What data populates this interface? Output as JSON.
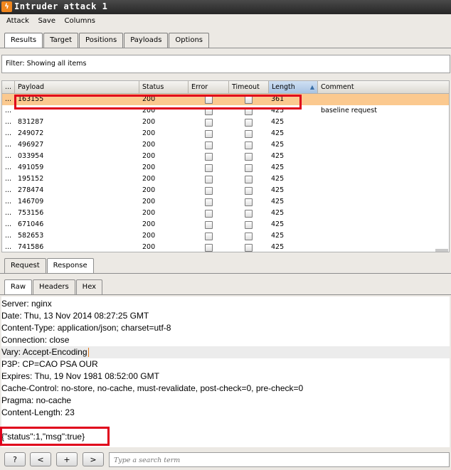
{
  "window": {
    "title": "Intruder attack 1",
    "logo_glyph": "ϟ"
  },
  "menu": [
    "Attack",
    "Save",
    "Columns"
  ],
  "main_tabs": [
    {
      "label": "Results",
      "active": true
    },
    {
      "label": "Target",
      "active": false
    },
    {
      "label": "Positions",
      "active": false
    },
    {
      "label": "Payloads",
      "active": false
    },
    {
      "label": "Options",
      "active": false
    }
  ],
  "filter": {
    "text": "Filter: Showing all items"
  },
  "results_table": {
    "columns": [
      "...",
      "Payload",
      "Status",
      "Error",
      "Timeout",
      "Length",
      "Comment"
    ],
    "sorted_column": "Length",
    "sort_direction": "ascending",
    "rows": [
      {
        "num": "...",
        "payload": "163155",
        "status": "200",
        "length": "361",
        "comment": "",
        "selected": true
      },
      {
        "num": "...",
        "payload": "",
        "status": "200",
        "length": "425",
        "comment": "baseline request",
        "selected": false
      },
      {
        "num": "...",
        "payload": "831287",
        "status": "200",
        "length": "425",
        "comment": "",
        "selected": false
      },
      {
        "num": "...",
        "payload": "249072",
        "status": "200",
        "length": "425",
        "comment": "",
        "selected": false
      },
      {
        "num": "...",
        "payload": "496927",
        "status": "200",
        "length": "425",
        "comment": "",
        "selected": false
      },
      {
        "num": "...",
        "payload": "033954",
        "status": "200",
        "length": "425",
        "comment": "",
        "selected": false
      },
      {
        "num": "...",
        "payload": "491059",
        "status": "200",
        "length": "425",
        "comment": "",
        "selected": false
      },
      {
        "num": "...",
        "payload": "195152",
        "status": "200",
        "length": "425",
        "comment": "",
        "selected": false
      },
      {
        "num": "...",
        "payload": "278474",
        "status": "200",
        "length": "425",
        "comment": "",
        "selected": false
      },
      {
        "num": "...",
        "payload": "146709",
        "status": "200",
        "length": "425",
        "comment": "",
        "selected": false
      },
      {
        "num": "...",
        "payload": "753156",
        "status": "200",
        "length": "425",
        "comment": "",
        "selected": false
      },
      {
        "num": "...",
        "payload": "671046",
        "status": "200",
        "length": "425",
        "comment": "",
        "selected": false
      },
      {
        "num": "...",
        "payload": "582653",
        "status": "200",
        "length": "425",
        "comment": "",
        "selected": false
      },
      {
        "num": "...",
        "payload": "741586",
        "status": "200",
        "length": "425",
        "comment": "",
        "selected": false
      }
    ]
  },
  "reqres_tabs": [
    {
      "label": "Request",
      "active": false
    },
    {
      "label": "Response",
      "active": true
    }
  ],
  "view_tabs": [
    {
      "label": "Raw",
      "active": true
    },
    {
      "label": "Headers",
      "active": false
    },
    {
      "label": "Hex",
      "active": false
    }
  ],
  "response": {
    "lines": [
      "Server: nginx",
      "Date: Thu, 13 Nov 2014 08:27:25 GMT",
      "Content-Type: application/json; charset=utf-8",
      "Connection: close",
      "Vary: Accept-Encoding",
      "P3P: CP=CAO PSA OUR",
      "Expires: Thu, 19 Nov 1981 08:52:00 GMT",
      "Cache-Control: no-store, no-cache, must-revalidate, post-check=0, pre-check=0",
      "Pragma: no-cache",
      "Content-Length: 23",
      "",
      "{\"status\":1,\"msg\":true}"
    ],
    "highlight_line": 4
  },
  "bottom": {
    "help_label": "?",
    "prev_label": "<",
    "add_label": "+",
    "next_label": ">",
    "search_placeholder": "Type a search term"
  },
  "colors": {
    "selected_row": "#fbc98f",
    "annotation_box": "#e0001b",
    "caret": "#e07a1e"
  }
}
